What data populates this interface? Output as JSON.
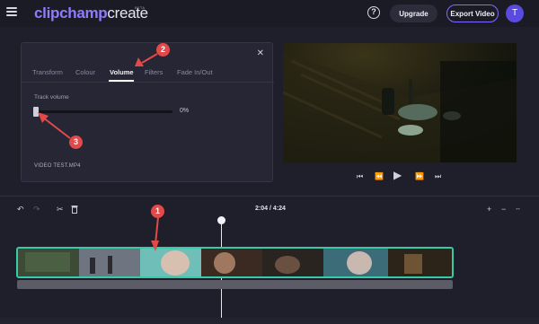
{
  "app": {
    "logo_primary": "clipchamp",
    "logo_secondary": "create",
    "logo_badge": "BETA"
  },
  "header": {
    "help_symbol": "?",
    "upgrade_label": "Upgrade",
    "export_label": "Export Video",
    "avatar_initial": "T",
    "accent_color": "#7e6bff"
  },
  "panel": {
    "close_symbol": "✕",
    "tabs": [
      {
        "label": "Transform"
      },
      {
        "label": "Colour"
      },
      {
        "label": "Volume",
        "active": true
      },
      {
        "label": "Filters"
      },
      {
        "label": "Fade In/Out"
      }
    ],
    "track_volume_label": "Track volume",
    "volume_value": "0%",
    "volume_level": 0,
    "clip_name": "VIDEO TEST.MP4"
  },
  "preview_controls": {
    "skip_start_icon": "skip-to-start-icon",
    "rewind_icon": "rewind-icon",
    "play_icon": "play-icon",
    "forward_icon": "fast-forward-icon",
    "skip_end_icon": "skip-to-end-icon"
  },
  "timeline": {
    "timecode": "2:04 / 4:24",
    "track_color": "#37c9a8"
  },
  "annotations": [
    {
      "label": "1"
    },
    {
      "label": "2"
    },
    {
      "label": "3"
    }
  ]
}
